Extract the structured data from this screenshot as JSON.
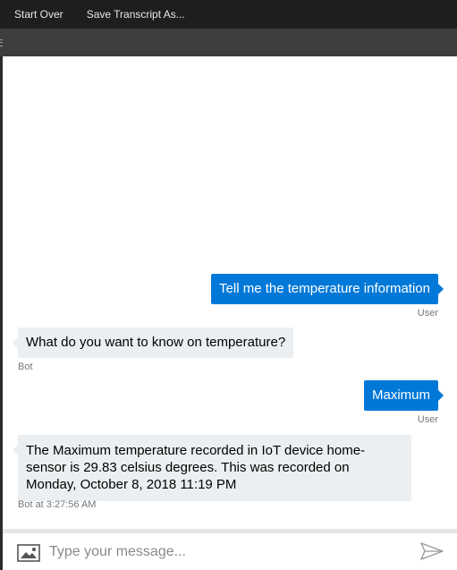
{
  "menubar": {
    "items": [
      "Start Over",
      "Save Transcript As..."
    ]
  },
  "messages": [
    {
      "from": "user",
      "text": "Tell me the temperature information",
      "meta": "User"
    },
    {
      "from": "bot",
      "text": "What do you want to know on temperature?",
      "meta": "Bot"
    },
    {
      "from": "user",
      "text": "Maximum",
      "meta": "User"
    },
    {
      "from": "bot",
      "text": "The Maximum temperature recorded in IoT device home-sensor is 29.83 celsius degrees. This was recorded on Monday, October 8, 2018 11:19 PM",
      "meta": "Bot at 3:27:56 AM"
    }
  ],
  "composer": {
    "placeholder": "Type your message...",
    "icons": {
      "attach": "image-icon",
      "send": "send-icon"
    }
  },
  "colors": {
    "user_bubble": "#0078d7",
    "bot_bubble": "#eceff1",
    "menubar": "#1e1e1e",
    "toolbar": "#3e3e3e"
  }
}
